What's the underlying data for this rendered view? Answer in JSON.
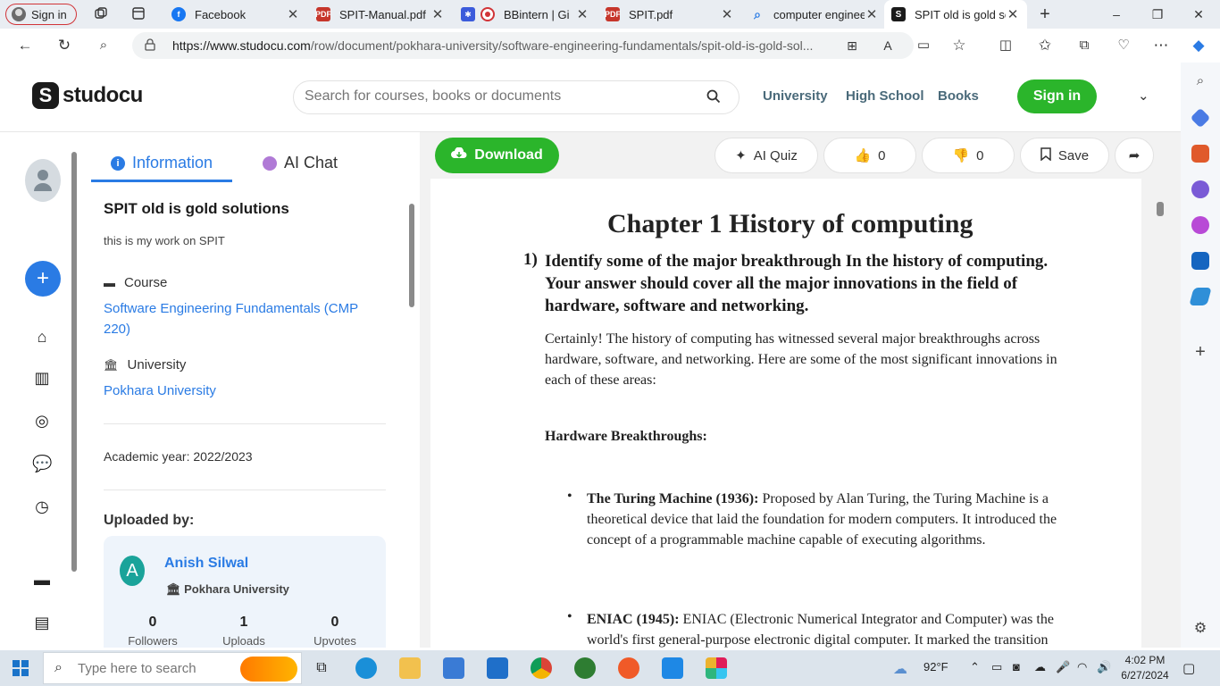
{
  "browser": {
    "profile_label": "Sign in",
    "tabs": [
      {
        "title": "Facebook",
        "favicon": "facebook-icon"
      },
      {
        "title": "SPIT-Manual.pdf",
        "favicon": "pdf-icon"
      },
      {
        "title": "BBintern | Gi",
        "favicon": "record-icon"
      },
      {
        "title": "SPIT.pdf",
        "favicon": "pdf-icon"
      },
      {
        "title": "computer engineer",
        "favicon": "search-icon"
      },
      {
        "title": "SPIT old is gold so",
        "favicon": "studocu-icon",
        "active": true
      }
    ],
    "url_domain": "https://www.studocu.com",
    "url_path": "/row/document/pokhara-university/software-engineering-fundamentals/spit-old-is-gold-sol..."
  },
  "header": {
    "logo_text": "studocu",
    "search_placeholder": "Search for courses, books or documents",
    "links": [
      "University",
      "High School",
      "Books"
    ],
    "sign_in": "Sign in"
  },
  "panel": {
    "tab_information": "Information",
    "tab_ai_chat": "AI Chat",
    "doc_title": "SPIT old is gold solutions",
    "doc_description": "this is my work on SPIT",
    "course_label": "Course",
    "course_name": "Software Engineering Fundamentals (CMP 220)",
    "university_label": "University",
    "university_name": "Pokhara University",
    "academic_year": "Academic year: 2022/2023",
    "uploaded_by_label": "Uploaded by:",
    "uploader": {
      "initial": "A",
      "name": "Anish Silwal",
      "university": "Pokhara University",
      "stats": [
        {
          "value": "0",
          "label": "Followers"
        },
        {
          "value": "1",
          "label": "Uploads"
        },
        {
          "value": "0",
          "label": "Upvotes"
        }
      ]
    }
  },
  "toolbar": {
    "download": "Download",
    "ai_quiz": "AI Quiz",
    "likes": "0",
    "dislikes": "0",
    "save": "Save"
  },
  "document": {
    "chapter_heading": "Chapter 1 History of computing",
    "question_number": "1)",
    "question": "Identify some of the major breakthrough In the history of computing. Your answer should cover all the major innovations in the field of hardware, software and networking.",
    "intro": "Certainly! The history of computing has witnessed several major breakthroughs across hardware, software, and networking. Here are some of the most significant innovations in each of these areas:",
    "section_heading": "Hardware Breakthroughs:",
    "items": [
      {
        "term": "The Turing Machine (1936):",
        "text": "Proposed by Alan Turing, the Turing Machine is a theoretical device that laid the foundation for modern computers. It introduced the concept of a programmable machine capable of executing algorithms."
      },
      {
        "term": "ENIAC (1945):",
        "text": "ENIAC (Electronic Numerical Integrator and Computer) was the world's first general-purpose electronic digital computer. It marked the transition from mechanical to electronic computing and accelerated computation significantly."
      }
    ]
  },
  "taskbar": {
    "search_placeholder": "Type here to search",
    "weather": "92°F",
    "time": "4:02 PM",
    "date": "6/27/2024"
  },
  "colors": {
    "brand_green": "#2bb52b",
    "link_blue": "#2a7be4",
    "signin_pill_border": "#d13438"
  }
}
